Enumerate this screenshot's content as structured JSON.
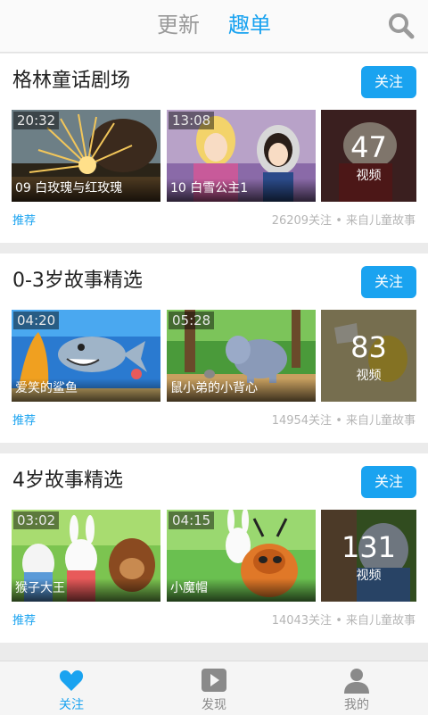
{
  "header": {
    "tab_update": "更新",
    "tab_list": "趣单",
    "active_tab": "趣单",
    "search_icon": "search-icon"
  },
  "sections": [
    {
      "title": "格林童话剧场",
      "follow_label": "关注",
      "videos": [
        {
          "duration": "20:32",
          "caption": "09 白玫瑰与红玫瑰"
        },
        {
          "duration": "13:08",
          "caption": "10 白雪公主1"
        }
      ],
      "more_count": "47",
      "more_label": "视频",
      "recommend": "推荐",
      "meta": "26209关注 • 来自儿童故事"
    },
    {
      "title": "0-3岁故事精选",
      "follow_label": "关注",
      "videos": [
        {
          "duration": "04:20",
          "caption": "爱笑的鲨鱼"
        },
        {
          "duration": "05:28",
          "caption": "鼠小弟的小背心"
        }
      ],
      "more_count": "83",
      "more_label": "视频",
      "recommend": "推荐",
      "meta": "14954关注 • 来自儿童故事"
    },
    {
      "title": "4岁故事精选",
      "follow_label": "关注",
      "videos": [
        {
          "duration": "03:02",
          "caption": "猴子大王"
        },
        {
          "duration": "04:15",
          "caption": "小魔帽"
        }
      ],
      "more_count": "131",
      "more_label": "视频",
      "recommend": "推荐",
      "meta": "14043关注 • 来自儿童故事"
    }
  ],
  "bottom_nav": [
    {
      "label": "关注",
      "icon": "heart-icon",
      "active": true
    },
    {
      "label": "发现",
      "icon": "play-icon",
      "active": false
    },
    {
      "label": "我的",
      "icon": "person-icon",
      "active": false
    }
  ],
  "colors": {
    "accent": "#1aa3f0",
    "background": "#ebebeb",
    "meta_text": "#b5b5b5"
  }
}
